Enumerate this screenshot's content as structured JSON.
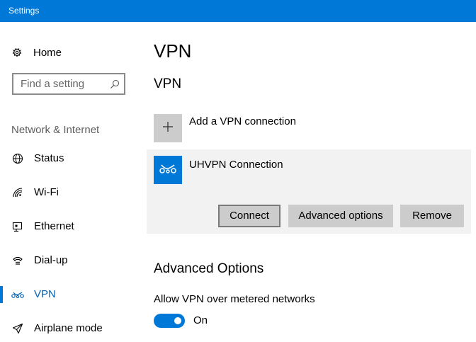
{
  "window": {
    "title": "Settings"
  },
  "sidebar": {
    "home_label": "Home",
    "search_placeholder": "Find a setting",
    "section_label": "Network & Internet",
    "items": [
      {
        "label": "Status",
        "icon": "globe-icon"
      },
      {
        "label": "Wi-Fi",
        "icon": "wifi-icon"
      },
      {
        "label": "Ethernet",
        "icon": "ethernet-icon"
      },
      {
        "label": "Dial-up",
        "icon": "dialup-icon"
      },
      {
        "label": "VPN",
        "icon": "vpn-icon",
        "active": true
      },
      {
        "label": "Airplane mode",
        "icon": "airplane-icon"
      }
    ]
  },
  "main": {
    "page_title": "VPN",
    "vpn_section_title": "VPN",
    "add_vpn_label": "Add a VPN connection",
    "connection": {
      "name": "UHVPN Connection",
      "buttons": {
        "connect": "Connect",
        "advanced": "Advanced options",
        "remove": "Remove"
      }
    },
    "advanced_heading": "Advanced Options",
    "metered_label": "Allow VPN over metered networks",
    "metered_toggle_state": "On",
    "metered_toggle_on": true
  },
  "colors": {
    "accent": "#0078d7",
    "active_text": "#0063b1",
    "panel_bg": "#f2f2f2",
    "button_bg": "#cccccc"
  }
}
